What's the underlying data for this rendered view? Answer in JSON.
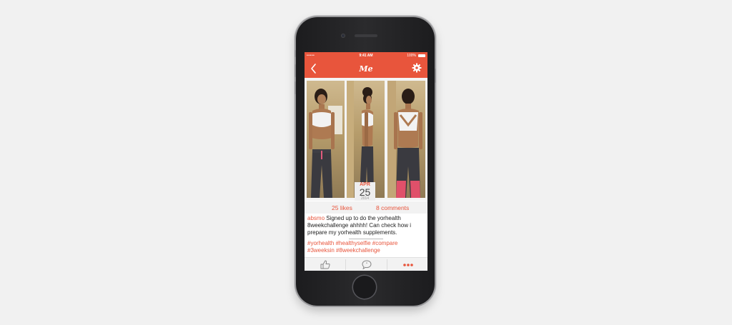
{
  "status_bar": {
    "carrier": "•••••",
    "time": "9:41 AM",
    "battery": "100%"
  },
  "header": {
    "title": "Me",
    "back_icon": "chevron-left-icon",
    "settings_icon": "gear-icon",
    "color": "#e8553c"
  },
  "post": {
    "date": {
      "month": "APR",
      "day": "25",
      "year": "2014"
    },
    "likes": "25 likes",
    "comments": "8 comments",
    "username": "absmo",
    "caption": " Signed up to do the yorhealth 8weekchallenge ahhhh! Can check how i prepare my yorhealth supplements.",
    "hashtags": [
      "#yorhealth",
      "#healthyselfie",
      "#compare",
      "#3weeksin",
      "#8weekchallenge"
    ]
  },
  "actions": {
    "like_icon": "thumbs-up-icon",
    "comment_icon": "speech-bubble-icon",
    "more_icon": "more-dots-icon"
  }
}
